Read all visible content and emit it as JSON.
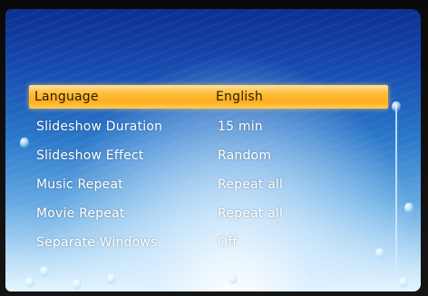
{
  "settings_menu": {
    "selected_index": 0,
    "items": [
      {
        "label": "Language",
        "value": "English"
      },
      {
        "label": "Slideshow Duration",
        "value": "15 min"
      },
      {
        "label": "Slideshow Effect",
        "value": "Random"
      },
      {
        "label": "Music Repeat",
        "value": "Repeat all"
      },
      {
        "label": "Movie Repeat",
        "value": "Repeat all"
      },
      {
        "label": "Separate Windows",
        "value": "Off"
      }
    ]
  },
  "icons": {
    "scroll_down": "↓"
  }
}
